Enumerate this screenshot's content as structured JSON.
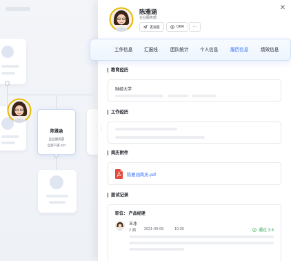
{
  "orgchart": {
    "employee": {
      "name": "陈雅涵",
      "dept": "企业服务部",
      "count_label": "全部下属  337"
    }
  },
  "panel": {
    "name": "陈雅涵",
    "dept": "企业服务部",
    "actions": [
      {
        "label": "发消息",
        "icon": "send-icon"
      },
      {
        "label": "OKR",
        "icon": "okr-icon"
      },
      {
        "label": "···",
        "icon": "more-icon"
      }
    ],
    "tabs": [
      "工作信息",
      "汇报线",
      "团队统计",
      "个人信息",
      "履历信息",
      "绩效信息"
    ],
    "active_tab": "履历信息",
    "education": {
      "title": "教育经历",
      "school": "财经大学"
    },
    "work": {
      "title": "工作经历"
    },
    "attachment": {
      "title": "简历附件",
      "file": "陈雅涵简历.pdf"
    },
    "interview": {
      "title": "面试记录",
      "position": "职位： 产品经理",
      "interviewer": "王冰",
      "round": "2 面",
      "date": "2021-09-08",
      "time": "10:30",
      "result": "通过 3.5"
    }
  },
  "colors": {
    "accent": "#3370ff",
    "pass": "#34a853",
    "pdf": "#e2483d"
  }
}
